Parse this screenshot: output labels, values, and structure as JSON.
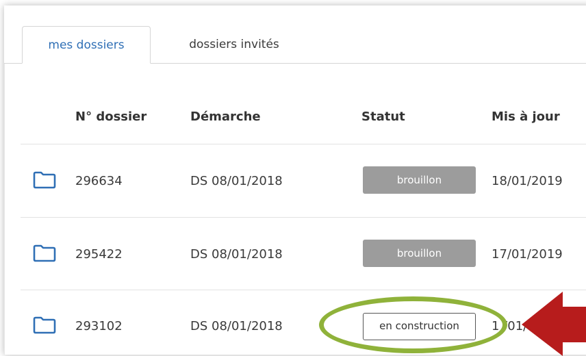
{
  "tabs": [
    {
      "label": "mes dossiers",
      "active": true
    },
    {
      "label": "dossiers invités",
      "active": false
    }
  ],
  "table": {
    "headers": {
      "number": "N° dossier",
      "procedure": "Démarche",
      "status": "Statut",
      "updated": "Mis à jour"
    },
    "rows": [
      {
        "number": "296634",
        "procedure": "DS 08/01/2018",
        "status": "brouillon",
        "updated": "18/01/2019",
        "icon": "folder-icon"
      },
      {
        "number": "295422",
        "procedure": "DS 08/01/2018",
        "status": "brouillon",
        "updated": "17/01/2019",
        "icon": "folder-icon"
      },
      {
        "number": "293102",
        "procedure": "DS 08/01/2018",
        "status": "en construction",
        "updated": "1 /01/",
        "icon": "folder-icon"
      }
    ]
  },
  "annotations": {
    "highlight": "ellipse",
    "highlight_color": "#8fb23a",
    "pointer": "arrow-left",
    "pointer_color": "#b71c1c"
  },
  "colors": {
    "accent_blue": "#2f6fb5",
    "status_draft": "#9c9c9c"
  }
}
